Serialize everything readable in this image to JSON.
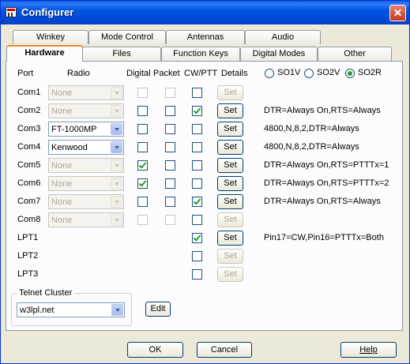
{
  "window": {
    "title": "Configurer",
    "close_glyph": "✕"
  },
  "tabs_back": [
    "Winkey",
    "Mode Control",
    "Antennas",
    "Audio"
  ],
  "tabs_front": [
    "Hardware",
    "Files",
    "Function Keys",
    "Digital Modes",
    "Other"
  ],
  "active_tab": "Hardware",
  "headers": {
    "port": "Port",
    "radio": "Radio",
    "digital": "Digital",
    "packet": "Packet",
    "cwptt": "CW/PTT",
    "details": "Details"
  },
  "so_options": [
    {
      "label": "SO1V",
      "selected": false
    },
    {
      "label": "SO2V",
      "selected": false
    },
    {
      "label": "SO2R",
      "selected": true
    }
  ],
  "ports": [
    {
      "port": "Com1",
      "radio": "None",
      "radio_enabled": false,
      "digital": false,
      "packet": false,
      "cwptt": false,
      "set_enabled": false,
      "details": ""
    },
    {
      "port": "Com2",
      "radio": "None",
      "radio_enabled": false,
      "digital": false,
      "packet": false,
      "cwptt": true,
      "set_enabled": true,
      "details": "DTR=Always On,RTS=Always"
    },
    {
      "port": "Com3",
      "radio": "FT-1000MP",
      "radio_enabled": true,
      "digital": false,
      "packet": false,
      "cwptt": false,
      "set_enabled": true,
      "details": "4800,N,8,2,DTR=Always"
    },
    {
      "port": "Com4",
      "radio": "Kenwood",
      "radio_enabled": true,
      "digital": false,
      "packet": false,
      "cwptt": false,
      "set_enabled": true,
      "details": "4800,N,8,2,DTR=Always"
    },
    {
      "port": "Com5",
      "radio": "None",
      "radio_enabled": false,
      "digital": true,
      "packet": false,
      "cwptt": false,
      "set_enabled": true,
      "details": "DTR=Always On,RTS=PTTTx=1"
    },
    {
      "port": "Com6",
      "radio": "None",
      "radio_enabled": false,
      "digital": true,
      "packet": false,
      "cwptt": false,
      "set_enabled": true,
      "details": "DTR=Always On,RTS=PTTTx=2"
    },
    {
      "port": "Com7",
      "radio": "None",
      "radio_enabled": false,
      "digital": false,
      "packet": false,
      "cwptt": true,
      "set_enabled": true,
      "details": "DTR=Always On,RTS=Always"
    },
    {
      "port": "Com8",
      "radio": "None",
      "radio_enabled": false,
      "digital": false,
      "packet": false,
      "cwptt": false,
      "set_enabled": false,
      "details": ""
    }
  ],
  "lpt_ports": [
    {
      "port": "LPT1",
      "cwptt": true,
      "set_enabled": true,
      "details": "Pin17=CW,Pin16=PTTTx=Both"
    },
    {
      "port": "LPT2",
      "cwptt": false,
      "set_enabled": false,
      "details": ""
    },
    {
      "port": "LPT3",
      "cwptt": false,
      "set_enabled": false,
      "details": ""
    }
  ],
  "set_label": "Set",
  "telnet": {
    "group_label": "Telnet Cluster",
    "value": "w3lpl.net",
    "edit_label": "Edit"
  },
  "buttons": {
    "ok": "OK",
    "cancel": "Cancel",
    "help": "Help"
  }
}
